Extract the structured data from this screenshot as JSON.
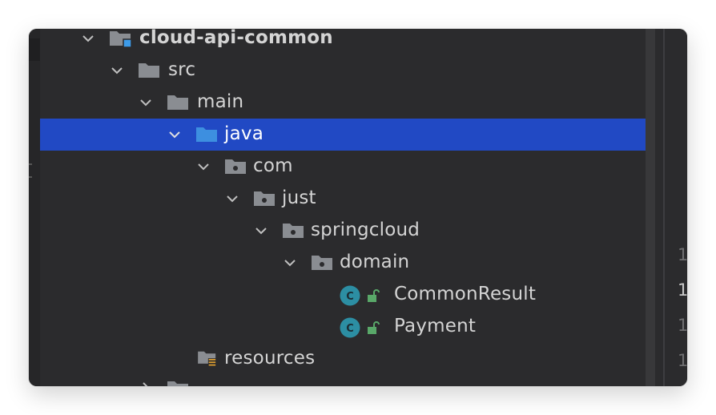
{
  "tree": {
    "items": [
      {
        "label": "cloud-api-common",
        "kind": "module"
      },
      {
        "label": "src",
        "kind": "folder"
      },
      {
        "label": "main",
        "kind": "folder"
      },
      {
        "label": "java",
        "kind": "source-root",
        "selected": true
      },
      {
        "label": "com",
        "kind": "package"
      },
      {
        "label": "just",
        "kind": "package"
      },
      {
        "label": "springcloud",
        "kind": "package"
      },
      {
        "label": "domain",
        "kind": "package"
      },
      {
        "label": "CommonResult",
        "kind": "class"
      },
      {
        "label": "Payment",
        "kind": "class"
      },
      {
        "label": "resources",
        "kind": "resources-root"
      }
    ]
  },
  "editor": {
    "line_numbers": [
      "1",
      "1",
      "1",
      "1"
    ]
  },
  "colors": {
    "background": "#2b2b2d",
    "selection": "#2149c4",
    "text": "#d4d4d4",
    "folder": "#8a8d92",
    "source_folder": "#3d8fe0",
    "class_icon": "#2c8ea3",
    "lock": "#59a869"
  }
}
